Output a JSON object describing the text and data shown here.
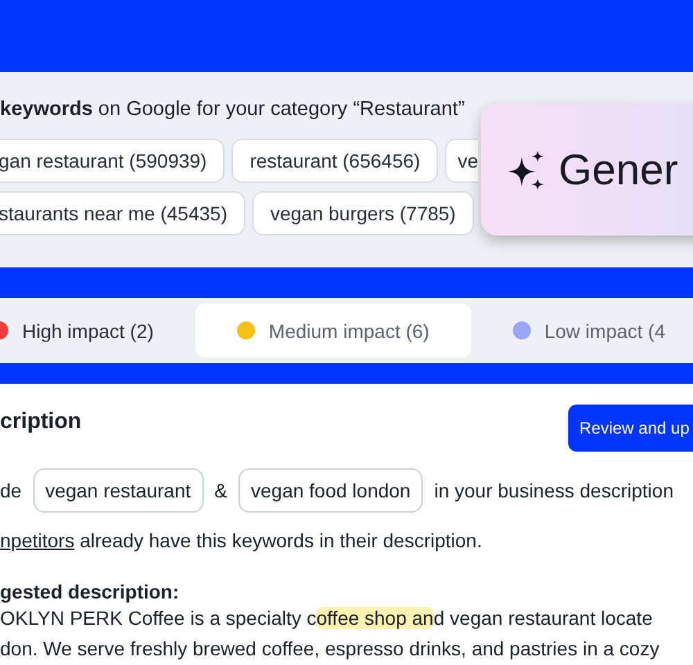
{
  "keywords_panel": {
    "intro": "**keywords** on Google for your category “Restaurant”",
    "chip_rows": [
      [
        "gan restaurant (590939)",
        "restaurant (656456)",
        "ve"
      ],
      [
        "staurants near me (45435)",
        "vegan burgers (7785)"
      ]
    ],
    "generate_button": {
      "label": "Gener"
    }
  },
  "impact_tabs": [
    {
      "label": "High impact (2)",
      "color": "#ef3b3b",
      "selected": false
    },
    {
      "label": "Medium impact (6)",
      "color": "#f5c116",
      "selected": true
    },
    {
      "label": "Low impact (4",
      "color": "#97a6f7",
      "selected": false
    }
  ],
  "description": {
    "title": "cription",
    "button": "Review and up",
    "include_row": {
      "lead": "de",
      "keywords": [
        "vegan restaurant",
        "vegan food london"
      ],
      "joiner": "&",
      "tail": "in your business description"
    },
    "competitors": {
      "link": "npetitors",
      "text": "already have this keywords in their description."
    },
    "suggested_label": "gested description:",
    "suggested_lines": [
      [
        {
          "text": "OKLYN PERK Coffee is a specialty c",
          "highlight": false
        },
        {
          "text": "offee shop an",
          "highlight": true
        },
        {
          "text": "d vegan restaurant locate",
          "highlight": false
        }
      ],
      [
        {
          "text": "don. We serve freshly brewed coffee, espresso drinks, and pastries in a cozy",
          "highlight": false
        }
      ]
    ]
  }
}
